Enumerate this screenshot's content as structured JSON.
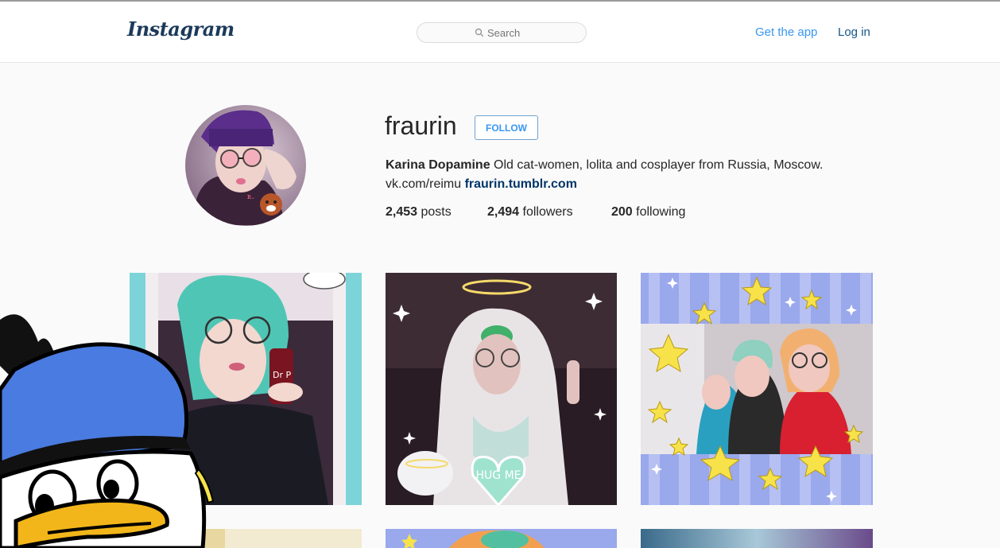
{
  "header": {
    "logo": "Instagram",
    "search_placeholder": "Search",
    "get_app": "Get the app",
    "login": "Log in"
  },
  "profile": {
    "username": "fraurin",
    "follow_label": "FOLLOW",
    "full_name": "Karina Dopamine",
    "bio": "Old cat-women, lolita and cosplayer from Russia, Moscow.",
    "bio_line2": "vk.com/reimu",
    "website": "fraurin.tumblr.com",
    "stats": {
      "posts_count": "2,453",
      "posts_label": "posts",
      "followers_count": "2,494",
      "followers_label": "followers",
      "following_count": "200",
      "following_label": "following"
    }
  },
  "posts": {
    "sticker_text": "HUG ME"
  },
  "colors": {
    "accent": "#3897f0",
    "link_dark": "#125688",
    "background": "#fafafa"
  }
}
